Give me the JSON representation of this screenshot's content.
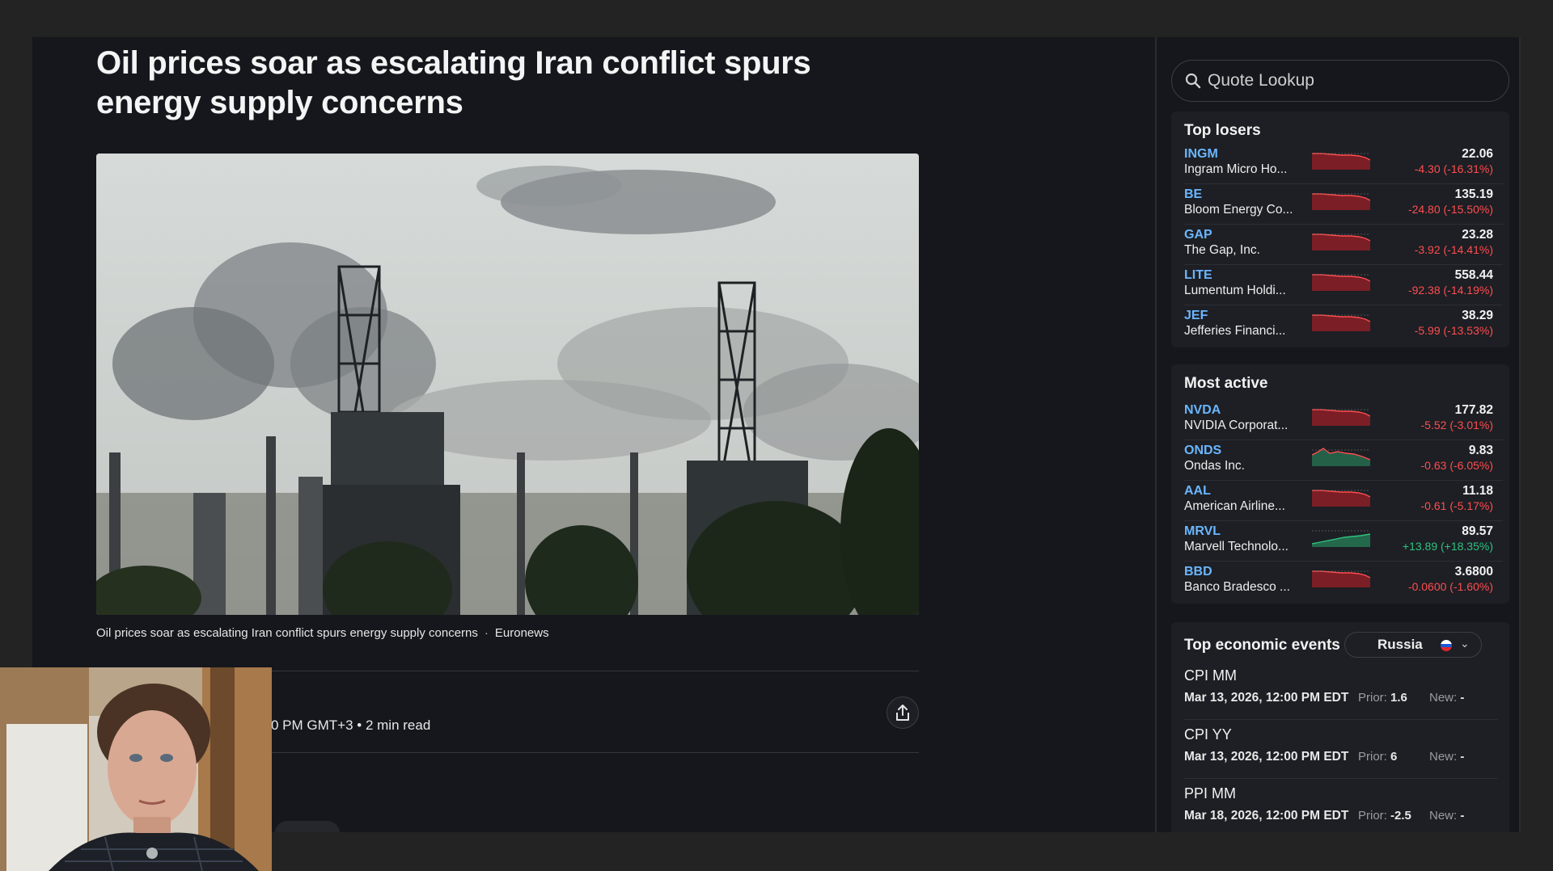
{
  "article": {
    "headline": "Oil prices soar as escalating Iran conflict spurs energy supply concerns",
    "caption": "Oil prices soar as escalating Iran conflict spurs energy supply concerns",
    "caption_source": "Euronews",
    "caption_separator": "·",
    "byline_partial": "0 PM GMT+3 • 2 min read",
    "share_icon": "share-icon",
    "hero_image": "oil-refinery-smoke-photo"
  },
  "sidebar": {
    "search": {
      "placeholder": "Quote Lookup",
      "icon": "search-icon"
    },
    "top_losers": {
      "title": "Top losers",
      "rows": [
        {
          "symbol": "INGM",
          "name": "Ingram Micro Ho...",
          "price": "22.06",
          "change": "-4.30 (-16.31%)",
          "direction": "down"
        },
        {
          "symbol": "BE",
          "name": "Bloom Energy Co...",
          "price": "135.19",
          "change": "-24.80 (-15.50%)",
          "direction": "down"
        },
        {
          "symbol": "GAP",
          "name": "The Gap, Inc.",
          "price": "23.28",
          "change": "-3.92 (-14.41%)",
          "direction": "down"
        },
        {
          "symbol": "LITE",
          "name": "Lumentum Holdi...",
          "price": "558.44",
          "change": "-92.38 (-14.19%)",
          "direction": "down"
        },
        {
          "symbol": "JEF",
          "name": "Jefferies Financi...",
          "price": "38.29",
          "change": "-5.99 (-13.53%)",
          "direction": "down"
        }
      ]
    },
    "most_active": {
      "title": "Most active",
      "rows": [
        {
          "symbol": "NVDA",
          "name": "NVIDIA Corporat...",
          "price": "177.82",
          "change": "-5.52 (-3.01%)",
          "direction": "down"
        },
        {
          "symbol": "ONDS",
          "name": "Ondas Inc.",
          "price": "9.83",
          "change": "-0.63 (-6.05%)",
          "direction": "mixed"
        },
        {
          "symbol": "AAL",
          "name": "American Airline...",
          "price": "11.18",
          "change": "-0.61 (-5.17%)",
          "direction": "down"
        },
        {
          "symbol": "MRVL",
          "name": "Marvell Technolo...",
          "price": "89.57",
          "change": "+13.89 (+18.35%)",
          "direction": "up"
        },
        {
          "symbol": "BBD",
          "name": "Banco Bradesco ...",
          "price": "3.6800",
          "change": "-0.0600 (-1.60%)",
          "direction": "down"
        }
      ]
    },
    "economic_events": {
      "title": "Top economic events",
      "country": "Russia",
      "country_flag_colors": [
        "#ffffff",
        "#1c57d6",
        "#e0242e"
      ],
      "prior_label": "Prior:",
      "new_label": "New:",
      "events": [
        {
          "name": "CPI MM",
          "date": "Mar 13, 2026, 12:00 PM EDT",
          "prior": "1.6",
          "new": "-"
        },
        {
          "name": "CPI YY",
          "date": "Mar 13, 2026, 12:00 PM EDT",
          "prior": "6",
          "new": "-"
        },
        {
          "name": "PPI MM",
          "date": "Mar 18, 2026, 12:00 PM EDT",
          "prior": "-2.5",
          "new": "-"
        }
      ]
    }
  },
  "colors": {
    "background": "#15171c",
    "card": "#1d1f24",
    "symbol_link": "#6ab6ff",
    "negative": "#ff4d4f",
    "positive": "#2ec27e"
  }
}
